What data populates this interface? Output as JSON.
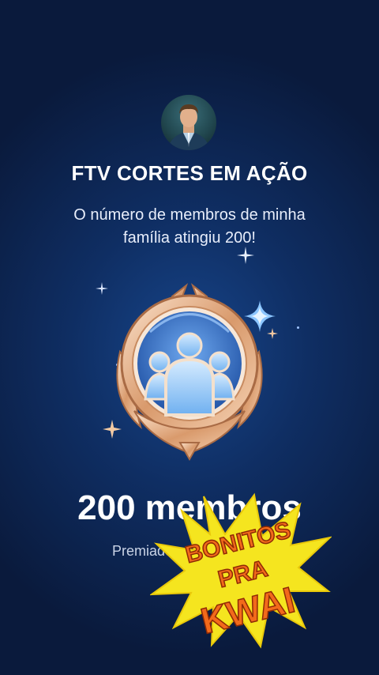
{
  "family": {
    "name": "FTV CORTES EM AÇÃO"
  },
  "message": {
    "line1": "O número de membros de minha",
    "line2": "família atingiu 200!"
  },
  "milestone": {
    "count_label": "200 membros",
    "awarded_label": "Premiado"
  },
  "sticker": {
    "line1": "BONITOS",
    "line2": "PRA",
    "line3": "KWAI"
  },
  "colors": {
    "background": "#0f2e63",
    "badge_gold": "#e8b48c",
    "badge_blue": "#4d8fe0",
    "sticker_yellow": "#f5e51f",
    "sticker_text": "#f26a1b"
  },
  "icons": [
    "avatar",
    "membership-badge-icon",
    "sparkle-icon"
  ]
}
